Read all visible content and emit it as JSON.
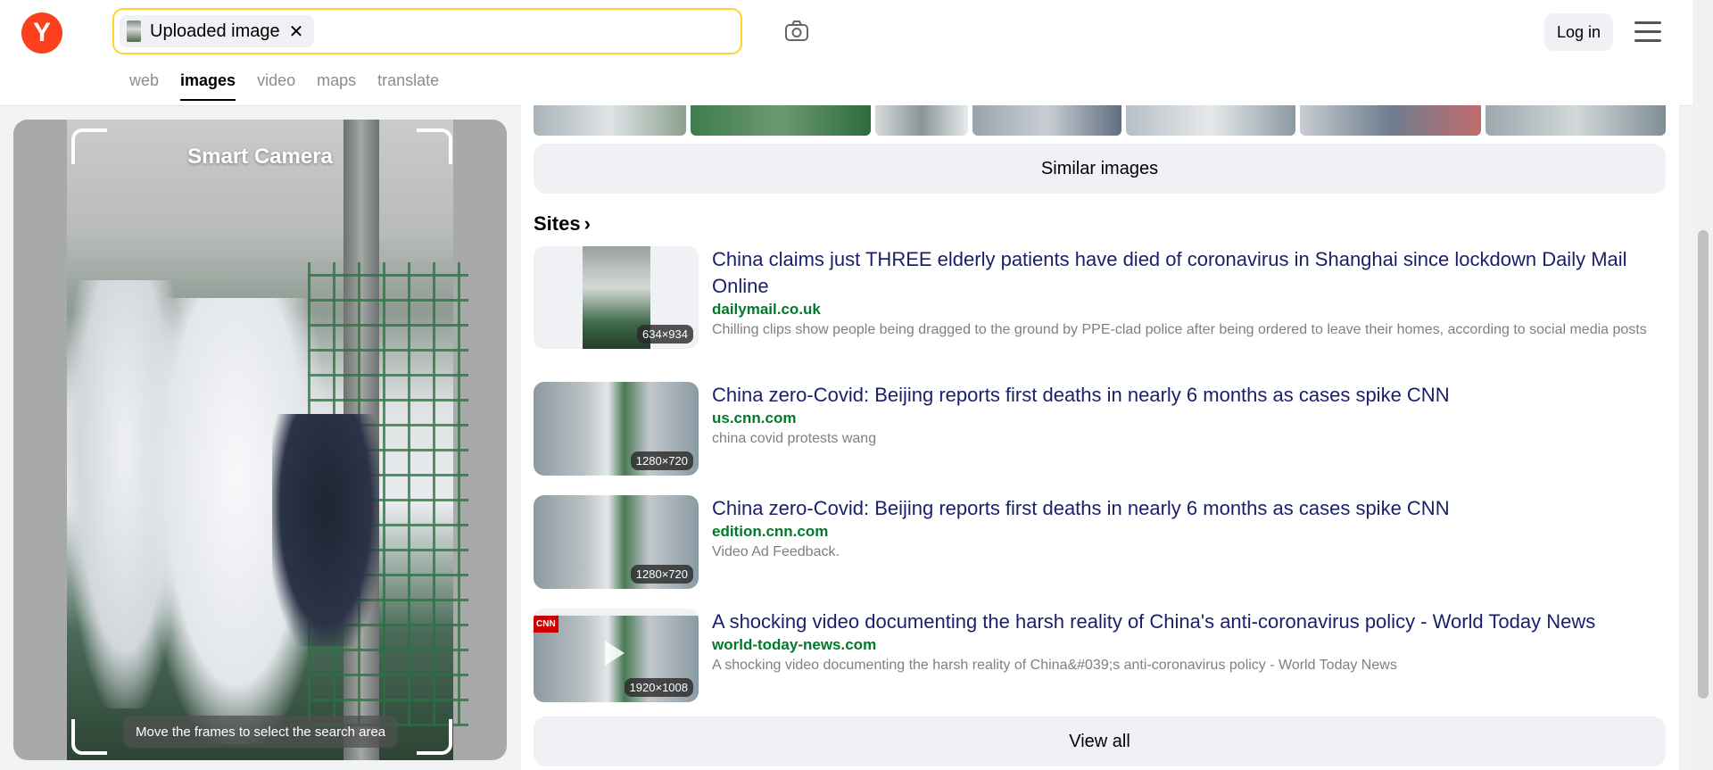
{
  "header": {
    "logo_letter": "Y",
    "search_chip_label": "Uploaded image",
    "search_chip_close": "✕",
    "login_label": "Log in",
    "tabs": [
      {
        "label": "web"
      },
      {
        "label": "images"
      },
      {
        "label": "video"
      },
      {
        "label": "maps"
      },
      {
        "label": "translate"
      }
    ],
    "active_tab": "images"
  },
  "left_panel": {
    "title": "Smart Camera",
    "hint": "Move the frames to select the search area"
  },
  "similar_button": "Similar images",
  "sites_heading": "Sites",
  "sites_chevron": "›",
  "results": [
    {
      "title": "China claims just THREE elderly patients have died of coronavirus in Shanghai since lockdown Daily Mail Online",
      "domain": "dailymail.co.uk",
      "description": "Chilling clips show people being dragged to the ground by PPE-clad police after being ordered to leave their homes, according to social media posts",
      "size": "634×934"
    },
    {
      "title": "China zero-Covid: Beijing reports first deaths in nearly 6 months as cases spike CNN",
      "domain": "us.cnn.com",
      "description": "china covid protests wang",
      "size": "1280×720"
    },
    {
      "title": "China zero-Covid: Beijing reports first deaths in nearly 6 months as cases spike CNN",
      "domain": "edition.cnn.com",
      "description": "Video Ad Feedback.",
      "size": "1280×720"
    },
    {
      "title": "A shocking video documenting the harsh reality of China's anti-coronavirus policy - World Today News",
      "domain": "world-today-news.com",
      "description": "A shocking video documenting the harsh reality of China&#039;s anti-coronavirus policy - World Today News",
      "size": "1920×1008",
      "badge": "CNN"
    }
  ],
  "view_all": "View all",
  "colors": {
    "brand": "#fc3f1d",
    "search_border": "#fed42b",
    "title_link": "#1a1f6c",
    "domain_green": "#007a2a"
  }
}
